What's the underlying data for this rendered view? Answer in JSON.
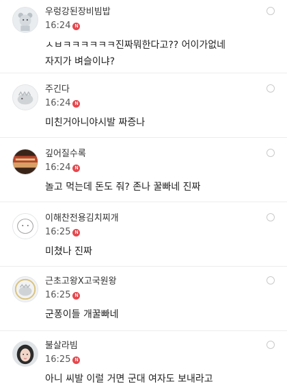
{
  "badge": "N",
  "comments": [
    {
      "nickname": "우렁강된장비빔밥",
      "time": "16:24",
      "lines": [
        "ㅅㅂㅋㅋㅋㅋㅋㅋ진짜뭐한다고?? 어이가없네",
        "자지가 벼슬이냐?"
      ]
    },
    {
      "nickname": "주긴다",
      "time": "16:24",
      "lines": [
        "미친거아니야시발 짜증나"
      ]
    },
    {
      "nickname": "깊어질수록",
      "time": "16:24",
      "lines": [
        "놀고 먹는데 돈도 줘? 존나 꿀빠네 진짜"
      ]
    },
    {
      "nickname": "이해찬전용김치찌개",
      "time": "16:25",
      "lines": [
        "미쳤나 진짜"
      ]
    },
    {
      "nickname": "근초고왕X고국원왕",
      "time": "16:25",
      "lines": [
        "군퐁이들 개꿀빠네"
      ]
    },
    {
      "nickname": "불살라빔",
      "time": "16:25",
      "lines": [
        "아니 씨발 이럴 거면 군대 여자도 보내라고"
      ]
    }
  ]
}
